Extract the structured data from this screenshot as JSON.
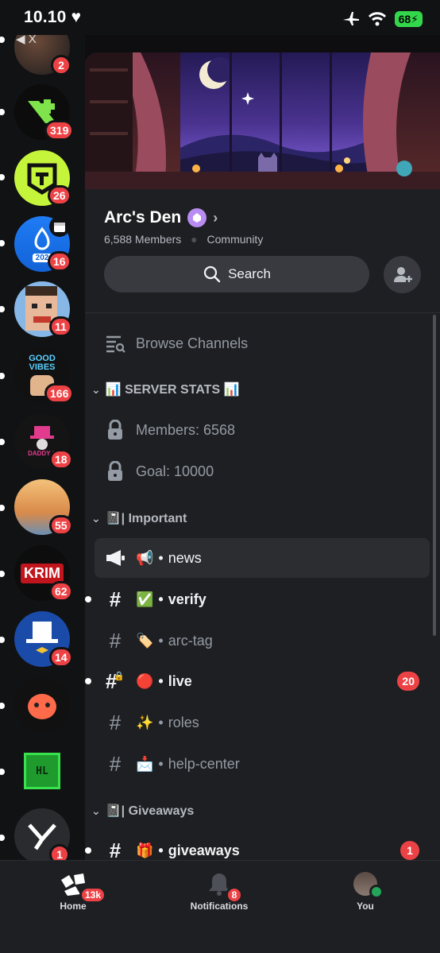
{
  "status_bar": {
    "time": "10.10",
    "battery": "68",
    "back_label": "◀ X"
  },
  "servers": [
    {
      "badge": "2"
    },
    {
      "badge": "319"
    },
    {
      "badge": "26"
    },
    {
      "badge": "16",
      "img_text": "202"
    },
    {
      "badge": "11"
    },
    {
      "badge": "166",
      "img_text": "GOOD VIBES"
    },
    {
      "badge": "18",
      "img_text": "DADDY S"
    },
    {
      "badge": "55"
    },
    {
      "badge": "62",
      "img_text": "KRIM"
    },
    {
      "badge": "14"
    },
    {
      "badge": ""
    },
    {
      "badge": "",
      "img_text": "HL"
    },
    {
      "badge": "1"
    }
  ],
  "server": {
    "name": "Arc's Den",
    "members": "6,588 Members",
    "type": "Community",
    "search_label": "Search"
  },
  "browse_channels": "Browse Channels",
  "categories": [
    {
      "label": "📊 SERVER STATS 📊"
    },
    {
      "label": "📓| Important"
    },
    {
      "label": "📓| Giveaways"
    }
  ],
  "channels": [
    {
      "emoji": "",
      "name": "Members: 6568"
    },
    {
      "emoji": "",
      "name": "Goal: 10000"
    },
    {
      "emoji": "📢",
      "name": "news"
    },
    {
      "emoji": "✅",
      "name": "verify"
    },
    {
      "emoji": "🏷️",
      "name": "arc-tag"
    },
    {
      "emoji": "🔴",
      "name": "live",
      "badge": "20"
    },
    {
      "emoji": "✨",
      "name": "roles"
    },
    {
      "emoji": "📩",
      "name": "help-center"
    },
    {
      "emoji": "🎁",
      "name": "giveaways",
      "badge": "1"
    }
  ],
  "tabs": {
    "home": {
      "label": "Home",
      "badge": "13k"
    },
    "notifications": {
      "label": "Notifications",
      "badge": "8"
    },
    "you": {
      "label": "You"
    }
  },
  "colors": {
    "background": "#1e1f22",
    "rail": "#111214",
    "badge": "#ed4245",
    "boost": "#b98cf2",
    "online": "#23a55a"
  }
}
